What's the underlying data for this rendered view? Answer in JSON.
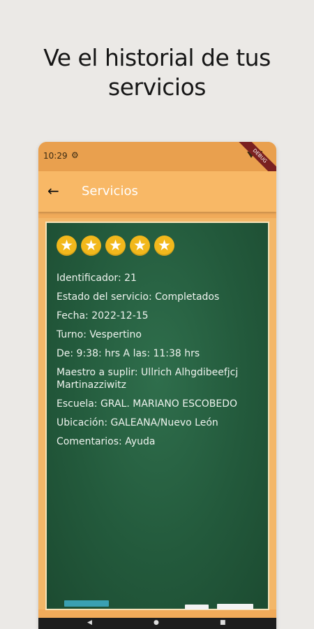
{
  "headline": {
    "line1": "Ve el historial de tus",
    "line2": "servicios"
  },
  "statusbar": {
    "time": "10:29",
    "gear_icon": "gear-icon",
    "debug_ribbon": "DEBUG"
  },
  "appbar": {
    "back_icon": "arrow-left-icon",
    "title": "Servicios"
  },
  "rating": {
    "stars": 5,
    "max": 5,
    "color": "#f2b81c"
  },
  "service": {
    "identificador": "Identificador: 21",
    "estado": "Estado del servicio: Completados",
    "fecha": "Fecha: 2022-12-15",
    "turno": "Turno: Vespertino",
    "horario": "De: 9:38: hrs A las: 11:38 hrs",
    "maestro_line1": "Maestro a suplir: Ullrich Alhgdibeefjcj",
    "maestro_line2": "Martinazziwitz",
    "escuela": "Escuela: GRAL. MARIANO ESCOBEDO",
    "ubicacion": "Ubicación: GALEANA/Nuevo León",
    "comentarios": "Comentarios: Ayuda"
  },
  "colors": {
    "appbar": "#f8b866",
    "statusbar": "#e9a04e",
    "chalkboard": "#235a3c",
    "frame": "#f3b768"
  }
}
